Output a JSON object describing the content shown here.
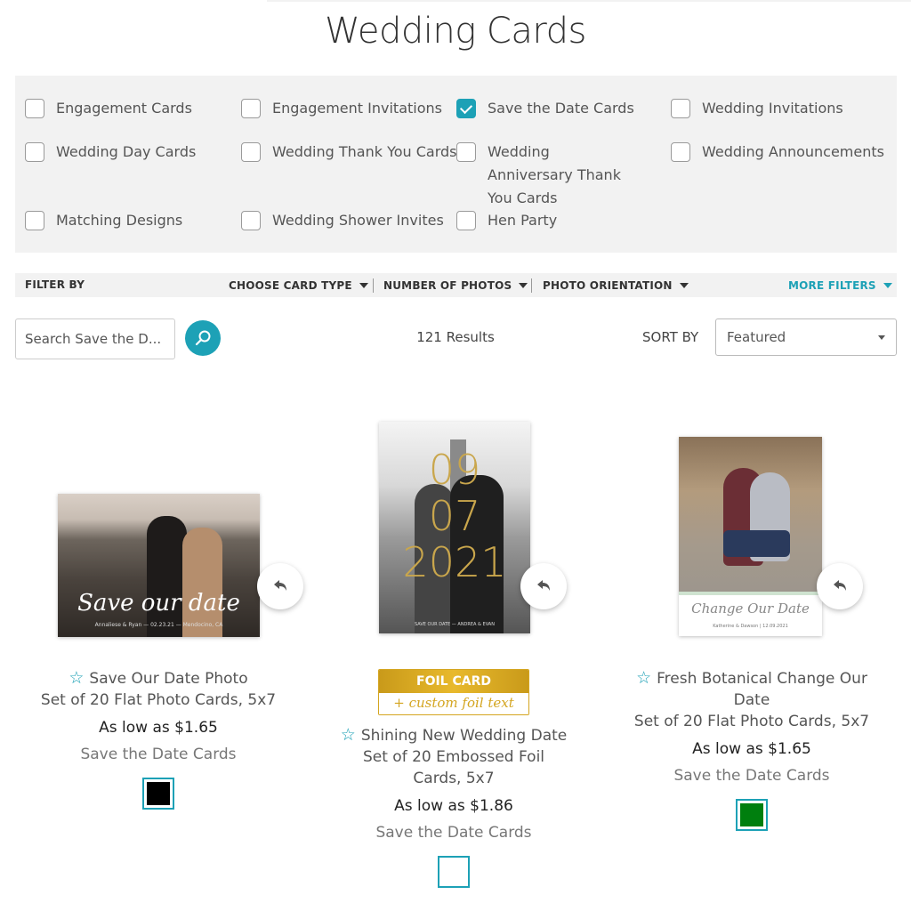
{
  "page": {
    "title": "Wedding Cards"
  },
  "categories": [
    {
      "label": "Engagement Cards",
      "checked": false
    },
    {
      "label": "Engagement Invitations",
      "checked": false
    },
    {
      "label": "Save the Date Cards",
      "checked": true
    },
    {
      "label": "Wedding Invitations",
      "checked": false
    },
    {
      "label": "Wedding Day Cards",
      "checked": false
    },
    {
      "label": "Wedding Thank You Cards",
      "checked": false
    },
    {
      "label": "Wedding Anniversary Thank You Cards",
      "checked": false
    },
    {
      "label": "Wedding Announcements",
      "checked": false
    },
    {
      "label": "Matching Designs",
      "checked": false
    },
    {
      "label": "Wedding Shower Invites",
      "checked": false
    },
    {
      "label": "Hen Party",
      "checked": false
    }
  ],
  "filter_bar": {
    "label": "FILTER BY",
    "options": [
      "CHOOSE CARD TYPE",
      "NUMBER OF PHOTOS",
      "PHOTO ORIENTATION"
    ],
    "more": "MORE FILTERS"
  },
  "search": {
    "value": "Search Save the D...",
    "placeholder": "Search Save the Date Cards",
    "button_icon": "search-icon"
  },
  "results": {
    "count_text": "121 Results"
  },
  "sort": {
    "label": "SORT BY",
    "selected": "Featured"
  },
  "colors": {
    "accent": "#1da1b6",
    "foil_gold": "#d4a520"
  },
  "products": [
    {
      "title": "Save Our Date Photo",
      "subtitle": "Set of 20 Flat Photo Cards, 5x7",
      "price": "As low as $1.65",
      "category": "Save the Date Cards",
      "swatch_color": "#000000",
      "card_text": {
        "headline": "Save our date",
        "footer": "Annaliese & Ryan — 02.23.21 — Mendocino, CA"
      },
      "favorite_icon": "star-outline-icon"
    },
    {
      "title": "Shining New Wedding Date",
      "subtitle": "Set of 20 Embossed Foil Cards, 5x7",
      "price": "As low as $1.86",
      "category": "Save the Date Cards",
      "swatch_color": "#ffffff",
      "badge": {
        "top": "FOIL CARD",
        "bottom": "+ custom foil text"
      },
      "card_text": {
        "lines": [
          "09",
          "07",
          "2021"
        ],
        "footer": "SAVE OUR DATE — ANDREA & EVAN"
      },
      "favorite_icon": "star-outline-icon"
    },
    {
      "title": "Fresh Botanical Change Our Date",
      "subtitle": "Set of 20 Flat Photo Cards, 5x7",
      "price": "As low as $1.65",
      "category": "Save the Date Cards",
      "swatch_color": "#007f0e",
      "card_text": {
        "headline": "Change Our Date",
        "footer": "Katherine & Dawson | 12.09.2021"
      },
      "favorite_icon": "star-outline-icon"
    }
  ]
}
